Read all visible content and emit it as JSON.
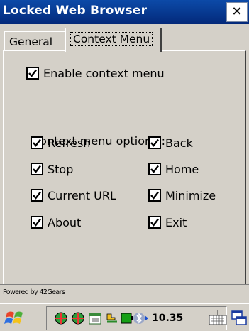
{
  "window": {
    "title": "Locked Web Browser",
    "close_glyph": "✕"
  },
  "tabs": [
    {
      "label": "General",
      "selected": false
    },
    {
      "label": "Context Menu",
      "selected": true
    }
  ],
  "context_menu": {
    "enable_label": "Enable context menu",
    "enable_checked": true,
    "options_label": "Context menu options :",
    "options": [
      {
        "label": "Refresh",
        "checked": true
      },
      {
        "label": "Back",
        "checked": true
      },
      {
        "label": "Stop",
        "checked": true
      },
      {
        "label": "Home",
        "checked": true
      },
      {
        "label": "Current URL",
        "checked": true
      },
      {
        "label": "Minimize",
        "checked": true
      },
      {
        "label": "About",
        "checked": true
      },
      {
        "label": "Exit",
        "checked": true
      }
    ]
  },
  "footer": {
    "powered_by": "Powered by 42Gears"
  },
  "taskbar": {
    "clock": "10.35",
    "icons": [
      "start-icon",
      "network-icon",
      "network-icon-2",
      "calendar-icon",
      "power-icon",
      "battery-icon",
      "bluetooth-icon",
      "arrow-icon",
      "keyboard-icon",
      "windows-icon"
    ]
  },
  "colors": {
    "titlebar": "#03297a",
    "face": "#d4d0c8"
  }
}
